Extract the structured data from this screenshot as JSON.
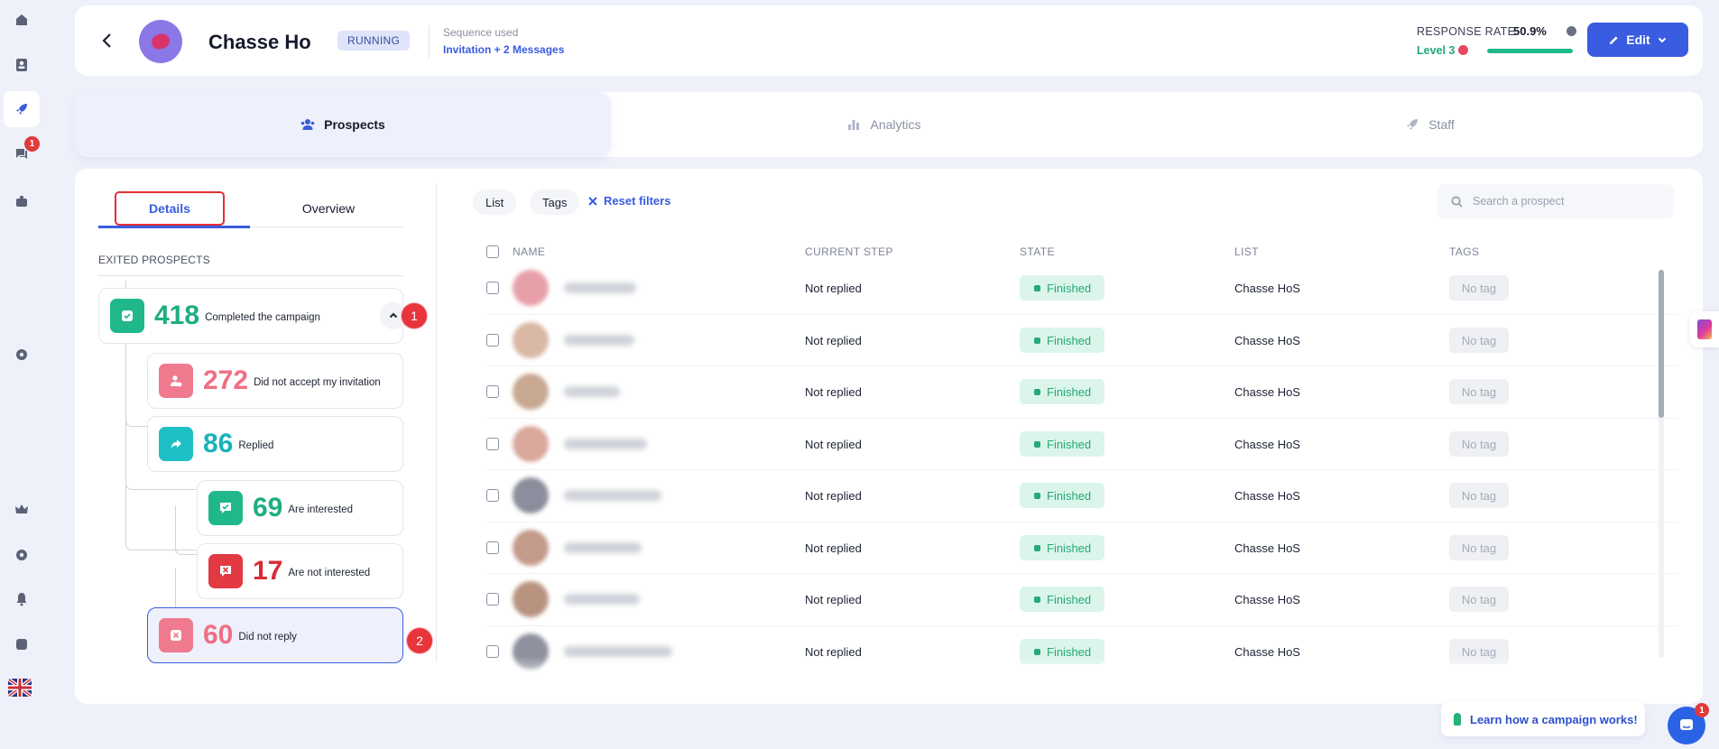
{
  "rail": {
    "messages_badge": "1",
    "icons": [
      "home-icon",
      "contacts-icon",
      "campaign-rocket-icon",
      "messages-icon",
      "briefcase-icon",
      "settings-icon",
      "crown-icon",
      "settings-icon",
      "bell-icon",
      "help-icon"
    ]
  },
  "header": {
    "title": "Chasse Ho",
    "status": "RUNNING",
    "sequence_label": "Sequence used",
    "sequence_value": "Invitation + 2 Messages",
    "response_rate_label": "RESPONSE RATE",
    "response_rate_value": "50.9%",
    "level": "Level 3",
    "level_progress_percent": 100,
    "edit_label": "Edit"
  },
  "tabs": [
    {
      "label": "Prospects",
      "active": true
    },
    {
      "label": "Analytics",
      "active": false
    },
    {
      "label": "Staff",
      "active": false
    }
  ],
  "details": {
    "subtabs": [
      "Details",
      "Overview"
    ],
    "section_title": "EXITED PROSPECTS",
    "stats": [
      {
        "value": "418",
        "label": "Completed the campaign"
      },
      {
        "value": "272",
        "label": "Did not accept my invitation"
      },
      {
        "value": "86",
        "label": "Replied"
      },
      {
        "value": "69",
        "label": "Are interested"
      },
      {
        "value": "17",
        "label": "Are not interested"
      },
      {
        "value": "60",
        "label": "Did not reply"
      }
    ],
    "markers": [
      "1",
      "2"
    ]
  },
  "filters": {
    "list_chip": "List",
    "tags_chip": "Tags",
    "reset": "Reset filters",
    "search_placeholder": "Search a prospect"
  },
  "table": {
    "columns": [
      "NAME",
      "CURRENT STEP",
      "STATE",
      "LIST",
      "TAGS"
    ],
    "rows": [
      {
        "step": "Not replied",
        "state": "Finished",
        "list": "Chasse HoS",
        "tag": "No tag"
      },
      {
        "step": "Not replied",
        "state": "Finished",
        "list": "Chasse HoS",
        "tag": "No tag"
      },
      {
        "step": "Not replied",
        "state": "Finished",
        "list": "Chasse HoS",
        "tag": "No tag"
      },
      {
        "step": "Not replied",
        "state": "Finished",
        "list": "Chasse HoS",
        "tag": "No tag"
      },
      {
        "step": "Not replied",
        "state": "Finished",
        "list": "Chasse HoS",
        "tag": "No tag"
      },
      {
        "step": "Not replied",
        "state": "Finished",
        "list": "Chasse HoS",
        "tag": "No tag"
      },
      {
        "step": "Not replied",
        "state": "Finished",
        "list": "Chasse HoS",
        "tag": "No tag"
      },
      {
        "step": "Not replied",
        "state": "Finished",
        "list": "Chasse HoS",
        "tag": "No tag"
      }
    ]
  },
  "help": {
    "learn_label": "Learn how a campaign works!",
    "chat_badge": "1"
  },
  "colors": {
    "accent": "#3a5ce0",
    "success": "#20b88a",
    "danger": "#e23942",
    "teal": "#1ec0c6",
    "pink": "#f07a8d"
  }
}
